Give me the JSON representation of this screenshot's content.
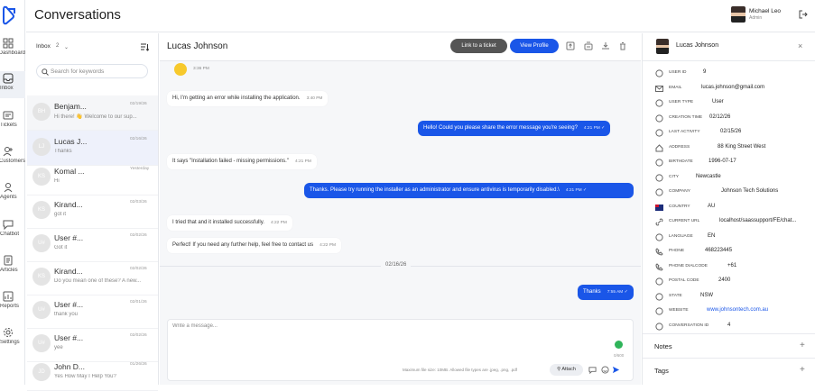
{
  "app": {
    "title": "Conversations"
  },
  "nav": {
    "items": [
      {
        "label": "Dashboard"
      },
      {
        "label": "Inbox"
      },
      {
        "label": "Tickets"
      },
      {
        "label": "Customers"
      },
      {
        "label": "Agents"
      },
      {
        "label": "Chatbot"
      },
      {
        "label": "Articles"
      },
      {
        "label": "Reports"
      },
      {
        "label": "Settings"
      }
    ]
  },
  "user": {
    "name": "Michael Leo",
    "role": "Admin"
  },
  "inbox": {
    "label": "Inbox",
    "count": "2",
    "search_placeholder": "Search for keywords"
  },
  "conversations": [
    {
      "initials": "BH",
      "name": "Benjam...",
      "preview": "Hi there! 👋 Welcome to our sup...",
      "date": "02/19/26"
    },
    {
      "initials": "LJ",
      "name": "Lucas J...",
      "preview": "Thanks",
      "date": "02/16/26"
    },
    {
      "initials": "KS",
      "name": "Komal ...",
      "preview": "Hi",
      "date": "Yesterday"
    },
    {
      "initials": "KS",
      "name": "Kirand...",
      "preview": "got it",
      "date": "02/03/26"
    },
    {
      "initials": "U#",
      "name": "User #...",
      "preview": "Got it",
      "date": "02/02/26"
    },
    {
      "initials": "KS",
      "name": "Kirand...",
      "preview": "Do you mean one of these? A new...",
      "date": "02/02/26"
    },
    {
      "initials": "U#",
      "name": "User #...",
      "preview": "thank you",
      "date": "02/01/26"
    },
    {
      "initials": "U#",
      "name": "User #...",
      "preview": "yee",
      "date": "02/02/26"
    },
    {
      "initials": "JD",
      "name": "John D...",
      "preview": "Yes How May I Help You?",
      "date": "01/26/26"
    }
  ],
  "chat": {
    "contact": "Lucas Johnson",
    "link_ticket_label": "Link to a ticket",
    "view_profile_label": "View Profile",
    "messages": [
      {
        "text": "",
        "time": "3:36 PM",
        "dir": "in"
      },
      {
        "text": "Hi, I'm getting an error while installing the application.",
        "time": "3:40 PM",
        "dir": "in"
      },
      {
        "text": "Hello! Could you please share the error message you're seeing?",
        "time": "4:21 PM ✓",
        "dir": "out"
      },
      {
        "text": "It says \"Installation failed - missing permissions.\"",
        "time": "4:21 PM",
        "dir": "in"
      },
      {
        "text": "Thanks. Please try running the installer as an administrator and ensure antivirus is temporarily disabled.\\",
        "time": "4:21 PM ✓",
        "dir": "out"
      },
      {
        "text": "I tried that and it installed successfully.",
        "time": "4:22 PM",
        "dir": "in"
      },
      {
        "text": "Perfect! If you need any further help, feel free to contact us",
        "time": "4:22 PM",
        "dir": "in"
      },
      {
        "text": "Thanks",
        "time": "7:55 AM ✓",
        "dir": "out"
      }
    ],
    "date_separator": "02/16/26",
    "composer_placeholder": "Write a message...",
    "char_counter": "0/600",
    "limits_note": "Maximum file size: 10MB. Allowed file types are .jpeg, .png, .pdf",
    "attach_label": "Attach"
  },
  "details": {
    "name": "Lucas Johnson",
    "fields": [
      {
        "key": "User ID",
        "value": "9"
      },
      {
        "key": "Email",
        "value": "lucas.johnson@gmail.com"
      },
      {
        "key": "User Type",
        "value": "User"
      },
      {
        "key": "Creation Time",
        "value": "02/12/26"
      },
      {
        "key": "Last Activity",
        "value": "02/15/26"
      },
      {
        "key": "Address",
        "value": "88 King Street West"
      },
      {
        "key": "Birthdate",
        "value": "1996-07-17"
      },
      {
        "key": "City",
        "value": "Newcastle"
      },
      {
        "key": "Company",
        "value": "Johnson Tech Solutions"
      },
      {
        "key": "Country",
        "value": "AU"
      },
      {
        "key": "Current URL",
        "value": "localhost/saassupport/FE/chat..."
      },
      {
        "key": "Language",
        "value": "EN"
      },
      {
        "key": "Phone",
        "value": "468223445"
      },
      {
        "key": "Phone Dialcode",
        "value": "+61"
      },
      {
        "key": "Postal Code",
        "value": "2400"
      },
      {
        "key": "State",
        "value": "NSW"
      },
      {
        "key": "Website",
        "value": "www.johnsontech.com.au"
      },
      {
        "key": "Conversation ID",
        "value": "4"
      }
    ],
    "notes_label": "Notes",
    "tags_label": "Tags"
  },
  "colors": {
    "accent": "#1a56e8",
    "dark_button": "#555555",
    "grammar": "#2fb45a"
  }
}
